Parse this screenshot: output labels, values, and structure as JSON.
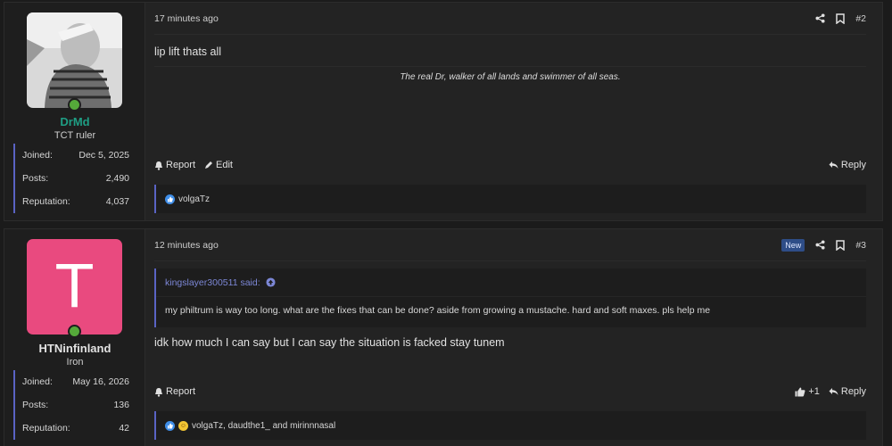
{
  "posts": [
    {
      "user": {
        "name": "DrMd",
        "title": "TCT ruler",
        "name_color": "#1f9e84"
      },
      "stats": [
        {
          "label": "Joined:",
          "value": "Dec 5, 2025"
        },
        {
          "label": "Posts:",
          "value": "2,490"
        },
        {
          "label": "Reputation:",
          "value": "4,037"
        }
      ],
      "time": "17 minutes ago",
      "number": "#2",
      "message": "lip lift thats all",
      "signature": "The real Dr, walker of all lands and swimmer of all seas.",
      "actions": {
        "report": "Report",
        "edit": "Edit",
        "reply": "Reply"
      },
      "reactions": "volgaTz"
    },
    {
      "user": {
        "name": "HTNinfinland",
        "title": "Iron",
        "avatar_letter": "T",
        "name_color": "#e3e3e3"
      },
      "stats": [
        {
          "label": "Joined:",
          "value": "May 16, 2026"
        },
        {
          "label": "Posts:",
          "value": "136"
        },
        {
          "label": "Reputation:",
          "value": "42"
        }
      ],
      "time": "12 minutes ago",
      "badge": "New",
      "number": "#3",
      "quote": {
        "author": "kingslayer300511 said:",
        "text": "my philtrum is way too long. what are the fixes that can be done? aside from growing a mustache. hard and soft maxes. pls help me"
      },
      "message": "idk how much I can say but I can say the situation is facked stay tunem",
      "actions": {
        "report": "Report",
        "like_count": "+1",
        "reply": "Reply"
      },
      "reactions": "volgaTz, daudthe1_ and mirinnnasal"
    }
  ]
}
